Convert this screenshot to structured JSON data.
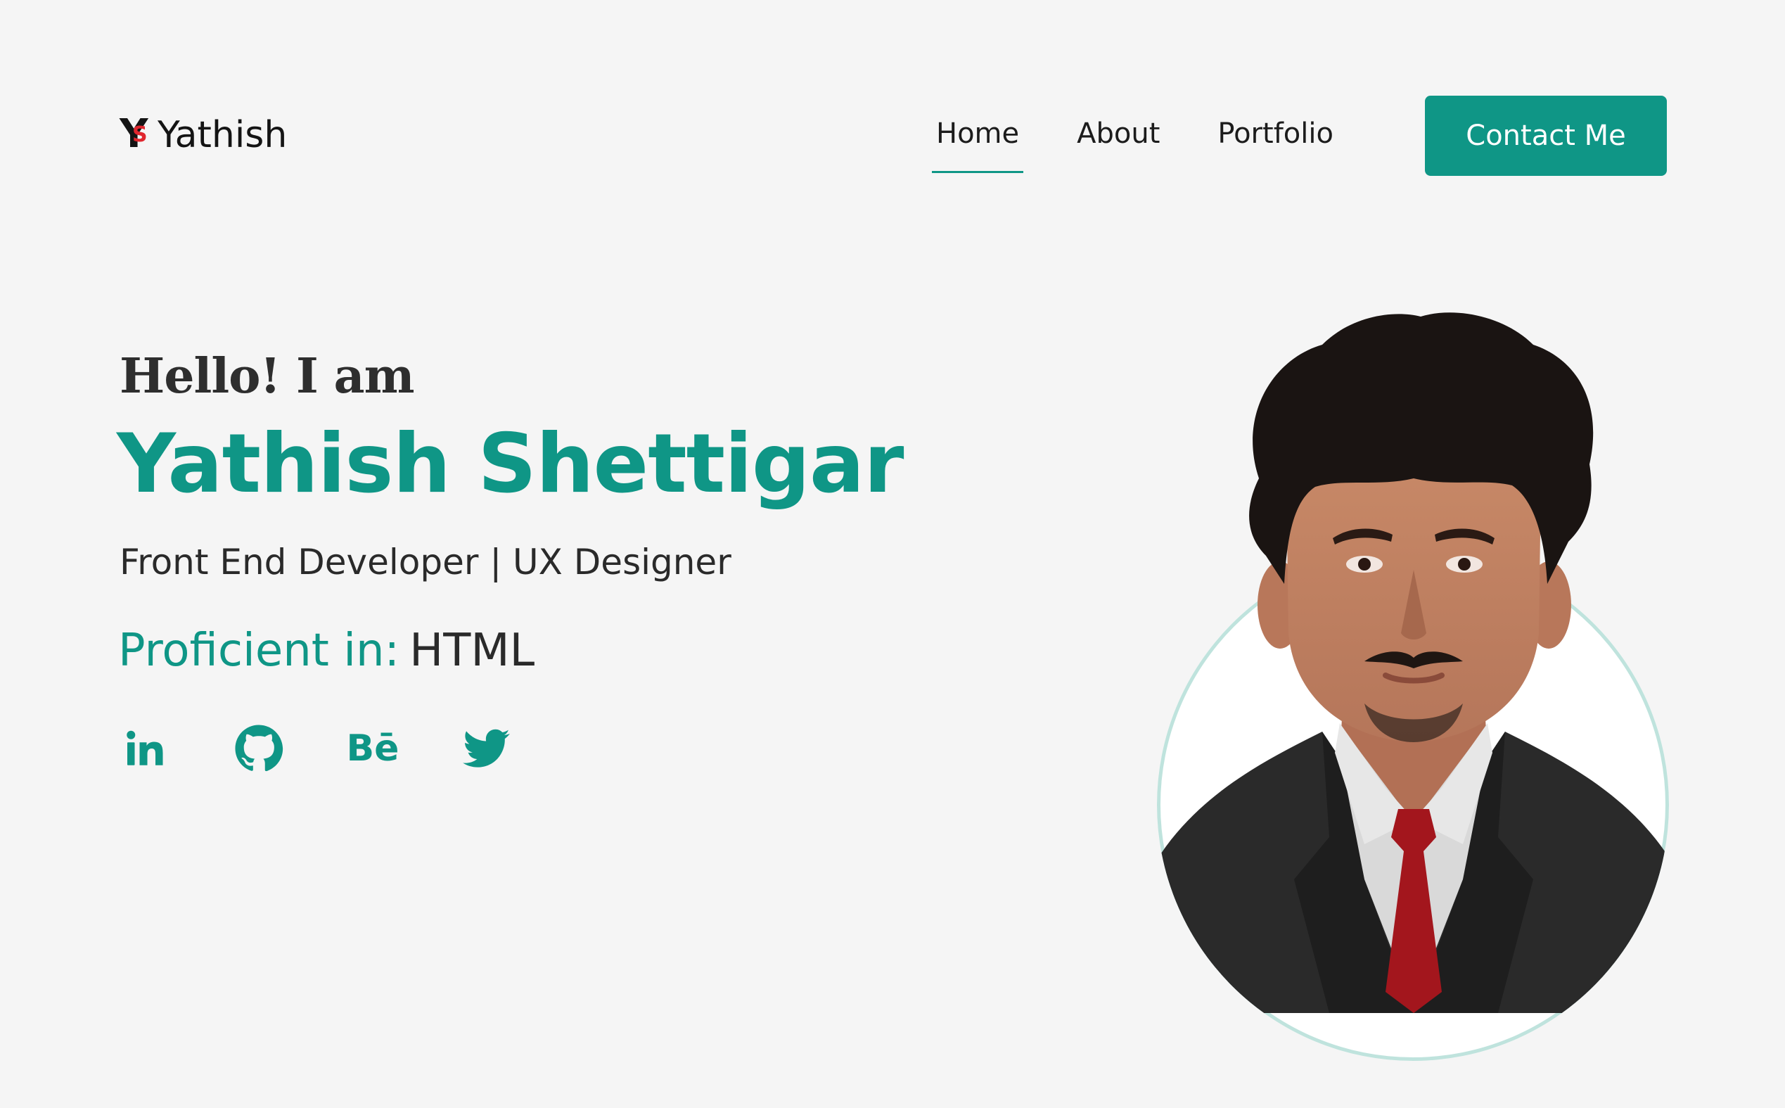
{
  "header": {
    "logo_text": "Yathish",
    "nav": [
      {
        "label": "Home",
        "active": true
      },
      {
        "label": "About",
        "active": false
      },
      {
        "label": "Portfolio",
        "active": false
      }
    ],
    "contact_label": "Contact Me"
  },
  "hero": {
    "greeting": "Hello! I am",
    "name": "Yathish Shettigar",
    "role": "Front End Developer | UX Designer",
    "proficient_label": "Proficient in:",
    "proficient_skill": "HTML"
  },
  "socials": [
    {
      "icon": "linkedin-icon"
    },
    {
      "icon": "github-icon"
    },
    {
      "icon": "behance-icon",
      "glyph": "Bē"
    },
    {
      "icon": "twitter-icon"
    }
  ],
  "colors": {
    "accent": "#0f9686",
    "background": "#f5f5f5",
    "text": "#2a2a2a",
    "logo_red": "#e0262e"
  }
}
